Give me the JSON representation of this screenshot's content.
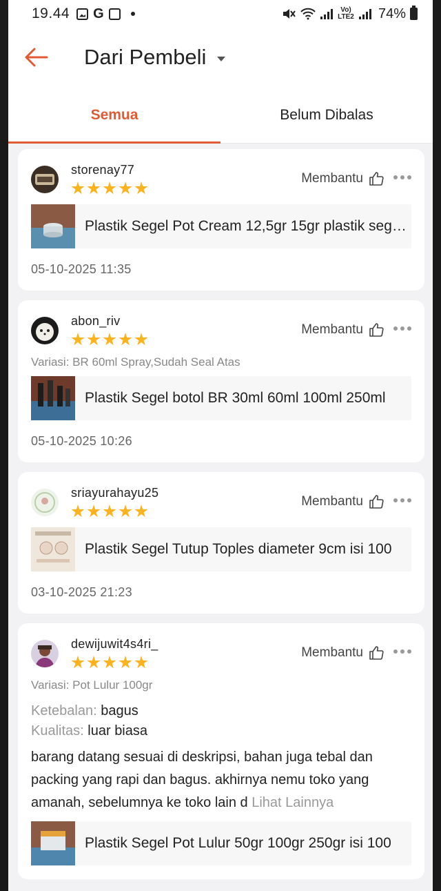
{
  "status_bar": {
    "time": "19.44",
    "battery": "74%",
    "network_label": "Vo) LTE2"
  },
  "header": {
    "title": "Dari Pembeli"
  },
  "tabs": [
    {
      "label": "Semua",
      "active": true
    },
    {
      "label": "Belum Dibalas",
      "active": false
    }
  ],
  "helpful_label": "Membantu",
  "reviews": [
    {
      "username": "storenay77",
      "rating": 5,
      "product": "Plastik Segel Pot Cream 12,5gr 15gr plastik segel pot",
      "date": "05-10-2025 11:35"
    },
    {
      "username": "abon_riv",
      "rating": 5,
      "variant": "Variasi: BR 60ml Spray,Sudah Seal Atas",
      "product": "Plastik Segel botol BR 30ml 60ml 100ml 250ml",
      "date": "05-10-2025 10:26"
    },
    {
      "username": "sriayurahayu25",
      "rating": 5,
      "product": "Plastik Segel Tutup Toples diameter 9cm isi 100",
      "date": "03-10-2025 21:23"
    },
    {
      "username": "dewijuwit4s4ri_",
      "rating": 5,
      "variant": "Variasi: Pot Lulur 100gr",
      "attr1_key": "Ketebalan:",
      "attr1_val": "bagus",
      "attr2_key": "Kualitas:",
      "attr2_val": "luar biasa",
      "text": "barang datang sesuai di deskripsi, bahan juga tebal dan packing yang rapi dan bagus. akhirnya nemu toko yang amanah, sebelumnya ke toko lain d",
      "see_more": "Lihat Lainnya",
      "product": "Plastik Segel Pot Lulur 50gr 100gr 250gr isi 100"
    }
  ],
  "colors": {
    "accent": "#e05a33",
    "star": "#fbb420"
  }
}
